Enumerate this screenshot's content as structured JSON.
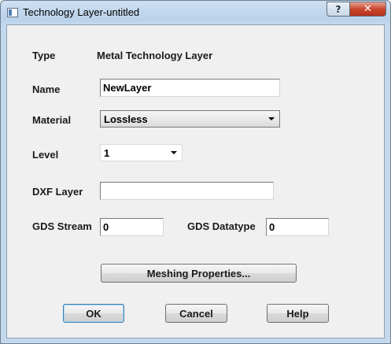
{
  "window": {
    "title": "Technology Layer-untitled",
    "help_button": "?",
    "close_button": "✕"
  },
  "form": {
    "type_label": "Type",
    "type_value": "Metal Technology Layer",
    "name_label": "Name",
    "name_value": "NewLayer",
    "material_label": "Material",
    "material_value": "Lossless",
    "level_label": "Level",
    "level_value": "1",
    "dxf_label": "DXF Layer",
    "dxf_value": "",
    "gds_stream_label": "GDS Stream",
    "gds_stream_value": "0",
    "gds_datatype_label": "GDS Datatype",
    "gds_datatype_value": "0"
  },
  "buttons": {
    "meshing": "Meshing Properties...",
    "ok": "OK",
    "cancel": "Cancel",
    "help": "Help"
  },
  "icons": {
    "app": "window-app-icon",
    "help": "help-icon",
    "close": "close-icon",
    "dropdown": "chevron-down-icon"
  }
}
